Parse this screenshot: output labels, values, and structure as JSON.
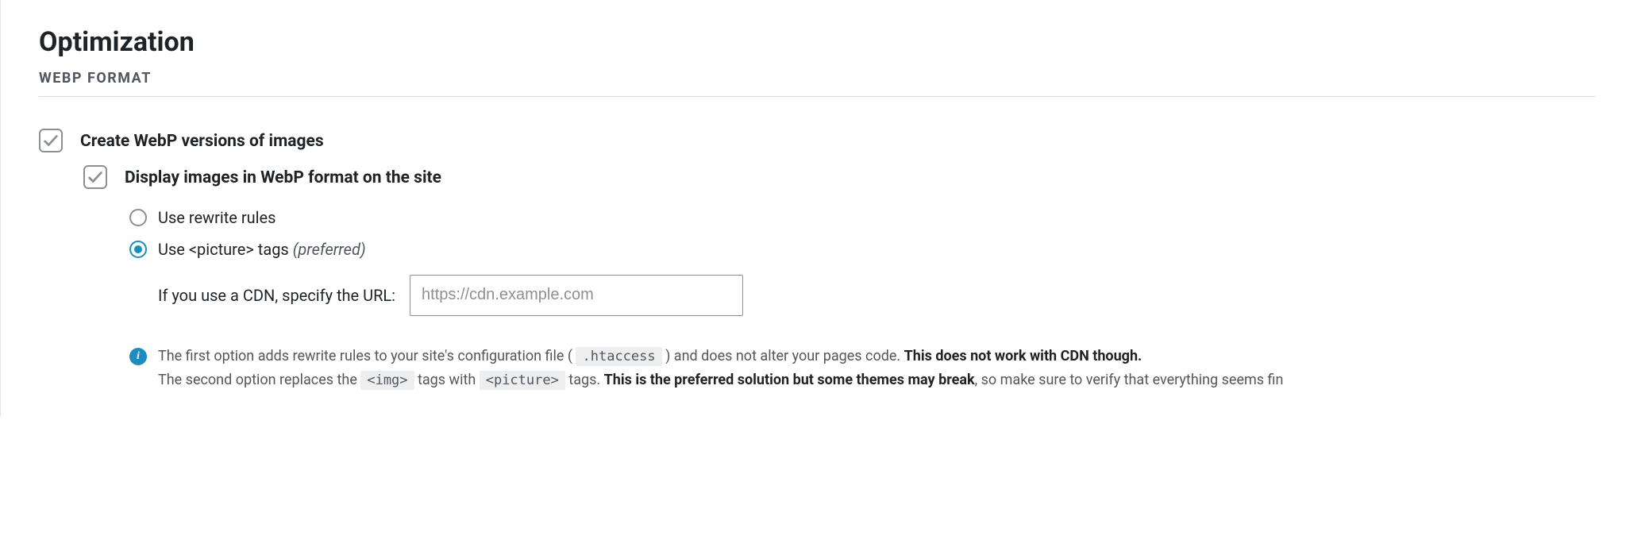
{
  "title": "Optimization",
  "subheading": "WEBP FORMAT",
  "create_webp": {
    "checked": true,
    "label": "Create WebP versions of images"
  },
  "display_webp": {
    "checked": true,
    "label": "Display images in WebP format on the site"
  },
  "radios": {
    "rewrite": "Use rewrite rules",
    "picture_prefix": "Use <picture> tags ",
    "picture_hint": "(preferred)",
    "selected": "picture"
  },
  "cdn": {
    "label": "If you use a CDN, specify the URL:",
    "placeholder": "https://cdn.example.com",
    "value": ""
  },
  "info": {
    "l1_a": "The first option adds rewrite rules to your site's configuration file ( ",
    "l1_code": ".htaccess",
    "l1_b": " ) and does not alter your pages code. ",
    "l1_strong": "This does not work with CDN though.",
    "l2_a": "The second option replaces the ",
    "l2_code1": "<img>",
    "l2_b": " tags with ",
    "l2_code2": "<picture>",
    "l2_c": " tags. ",
    "l2_strong": "This is the preferred solution but some themes may break",
    "l2_d": ", so make sure to verify that everything seems fin"
  }
}
